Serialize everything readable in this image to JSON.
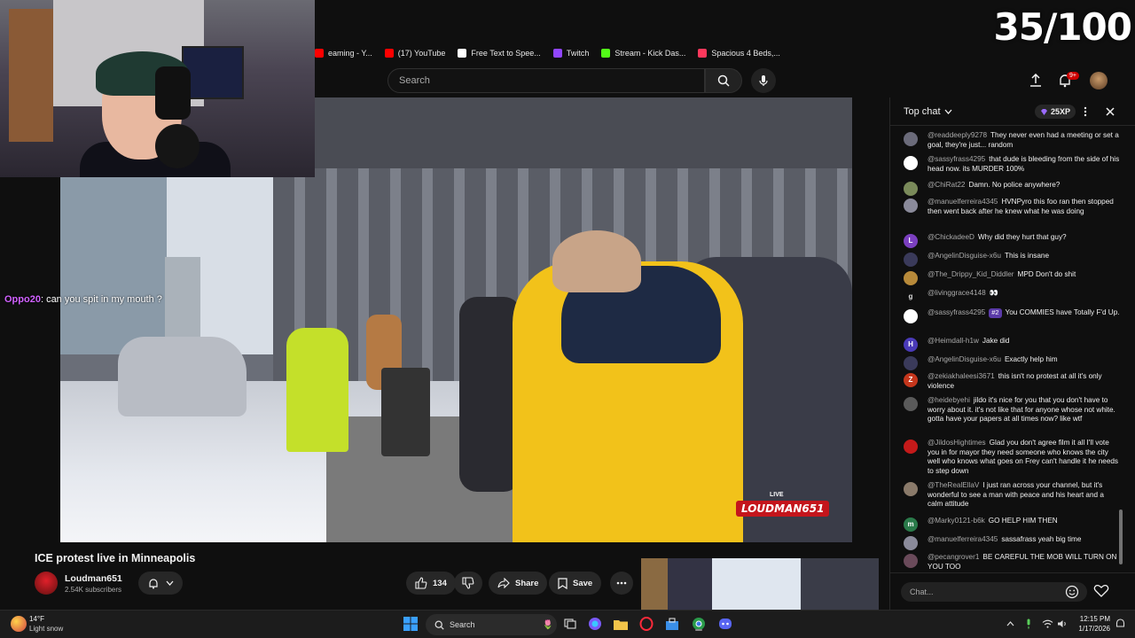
{
  "counter": "35/100",
  "bookmarks": [
    {
      "label": "eaming - Y...",
      "color": "#ff0000"
    },
    {
      "label": "(17) YouTube",
      "color": "#ff0000"
    },
    {
      "label": "Free Text to Spee...",
      "color": "#ffffff"
    },
    {
      "label": "Twitch",
      "color": "#9146ff"
    },
    {
      "label": "Stream - Kick Das...",
      "color": "#53fc18"
    },
    {
      "label": "Spacious 4 Beds,...",
      "color": "#ff385c"
    }
  ],
  "header": {
    "search_placeholder": "Search",
    "notif_count": "9+"
  },
  "overlay_chat": {
    "user": "Oppo20",
    "message": ": can you spit in my mouth ?"
  },
  "video": {
    "logo_text": "LOUDMAN651",
    "logo_live": "LIVE"
  },
  "below": {
    "title": "ICE protest live in Minneapolis",
    "channel": "Loudman651",
    "subscribers": "2.54K subscribers",
    "likes": "134",
    "share": "Share",
    "save": "Save"
  },
  "chat": {
    "title": "Top chat",
    "xp": "25XP",
    "input_placeholder": "Chat...",
    "messages": [
      {
        "author": "@readdeeply9278",
        "text": "They never even had a meeting or set a goal, they're just... random",
        "avatar": "",
        "color": "#6b6b7a",
        "badge": ""
      },
      {
        "author": "@sassyfrass4295",
        "text": "that dude is bleeding from the side of his head now. its MURDER 100%",
        "avatar": "",
        "color": "#ffffff",
        "badge": ""
      },
      {
        "author": "@ChiRat22",
        "text": "Damn. No police anywhere?",
        "avatar": "",
        "color": "#7a8a5a",
        "badge": ""
      },
      {
        "author": "@manuelferreira4345",
        "text": "HVNPyro this foo ran then stopped then went back after he knew what he was doing",
        "avatar": "",
        "color": "#8a8a9a",
        "badge": ""
      },
      {
        "author": "@ChickadeeD",
        "text": "Why did they hurt that guy?",
        "avatar": "L",
        "color": "#7b3fbf",
        "badge": ""
      },
      {
        "author": "@AngelinDisguise-x6u",
        "text": "This is insane",
        "avatar": "",
        "color": "#3a3a5a",
        "badge": ""
      },
      {
        "author": "@The_Drippy_Kid_Diddler",
        "text": "MPD Don't do shit",
        "avatar": "",
        "color": "#b88a3a",
        "badge": ""
      },
      {
        "author": "@livinggrace4148",
        "text": "👀",
        "avatar": "g",
        "color": "#0f0f0f",
        "badge": ""
      },
      {
        "author": "@sassyfrass4295",
        "text": "You COMMIES have Totally F'd Up.",
        "avatar": "",
        "color": "#ffffff",
        "badge": "#2"
      },
      {
        "author": "@Heimdall-h1w",
        "text": "Jake did",
        "avatar": "H",
        "color": "#4a3ab8",
        "badge": ""
      },
      {
        "author": "@AngelinDisguise-x6u",
        "text": "Exactly help him",
        "avatar": "",
        "color": "#3a3a5a",
        "badge": ""
      },
      {
        "author": "@zekiakhaleesi3671",
        "text": "this isn't no protest at all it's only violence",
        "avatar": "Z",
        "color": "#c4361c",
        "badge": ""
      },
      {
        "author": "@heidebyehi",
        "text": "jildo it's nice for you that you don't have to worry about it. it's not like that for anyone whose not white. gotta have your papers at all times now? like wtf",
        "avatar": "",
        "color": "#5a5a5a",
        "badge": ""
      },
      {
        "author": "@JildosHightimes",
        "text": "Glad you don't agree film it all I'll vote you in for mayor they need someone who knows the city well who knows what goes on Frey can't handle it he needs to step down",
        "avatar": "",
        "color": "#c41a1a",
        "badge": ""
      },
      {
        "author": "@TheRealEllaV",
        "text": "I just ran across your channel, but it's wonderful to see a man with peace and his heart and a calm attitude",
        "avatar": "",
        "color": "#8a7a6a",
        "badge": ""
      },
      {
        "author": "@Marky0121-b6k",
        "text": "GO HELP HIM THEN",
        "avatar": "m",
        "color": "#2a7a4a",
        "badge": ""
      },
      {
        "author": "@manuelferreira4345",
        "text": "sassafrass yeah big time",
        "avatar": "",
        "color": "#8a8a9a",
        "badge": ""
      },
      {
        "author": "@pecangrover1",
        "text": "BE CAREFUL THE MOB WILL TURN ON YOU TOO",
        "avatar": "",
        "color": "#6a4a5a",
        "badge": ""
      }
    ]
  },
  "taskbar": {
    "temp": "14°F",
    "weather": "Light snow",
    "search": "Search",
    "time": "12:15 PM",
    "date": "1/17/2026"
  }
}
